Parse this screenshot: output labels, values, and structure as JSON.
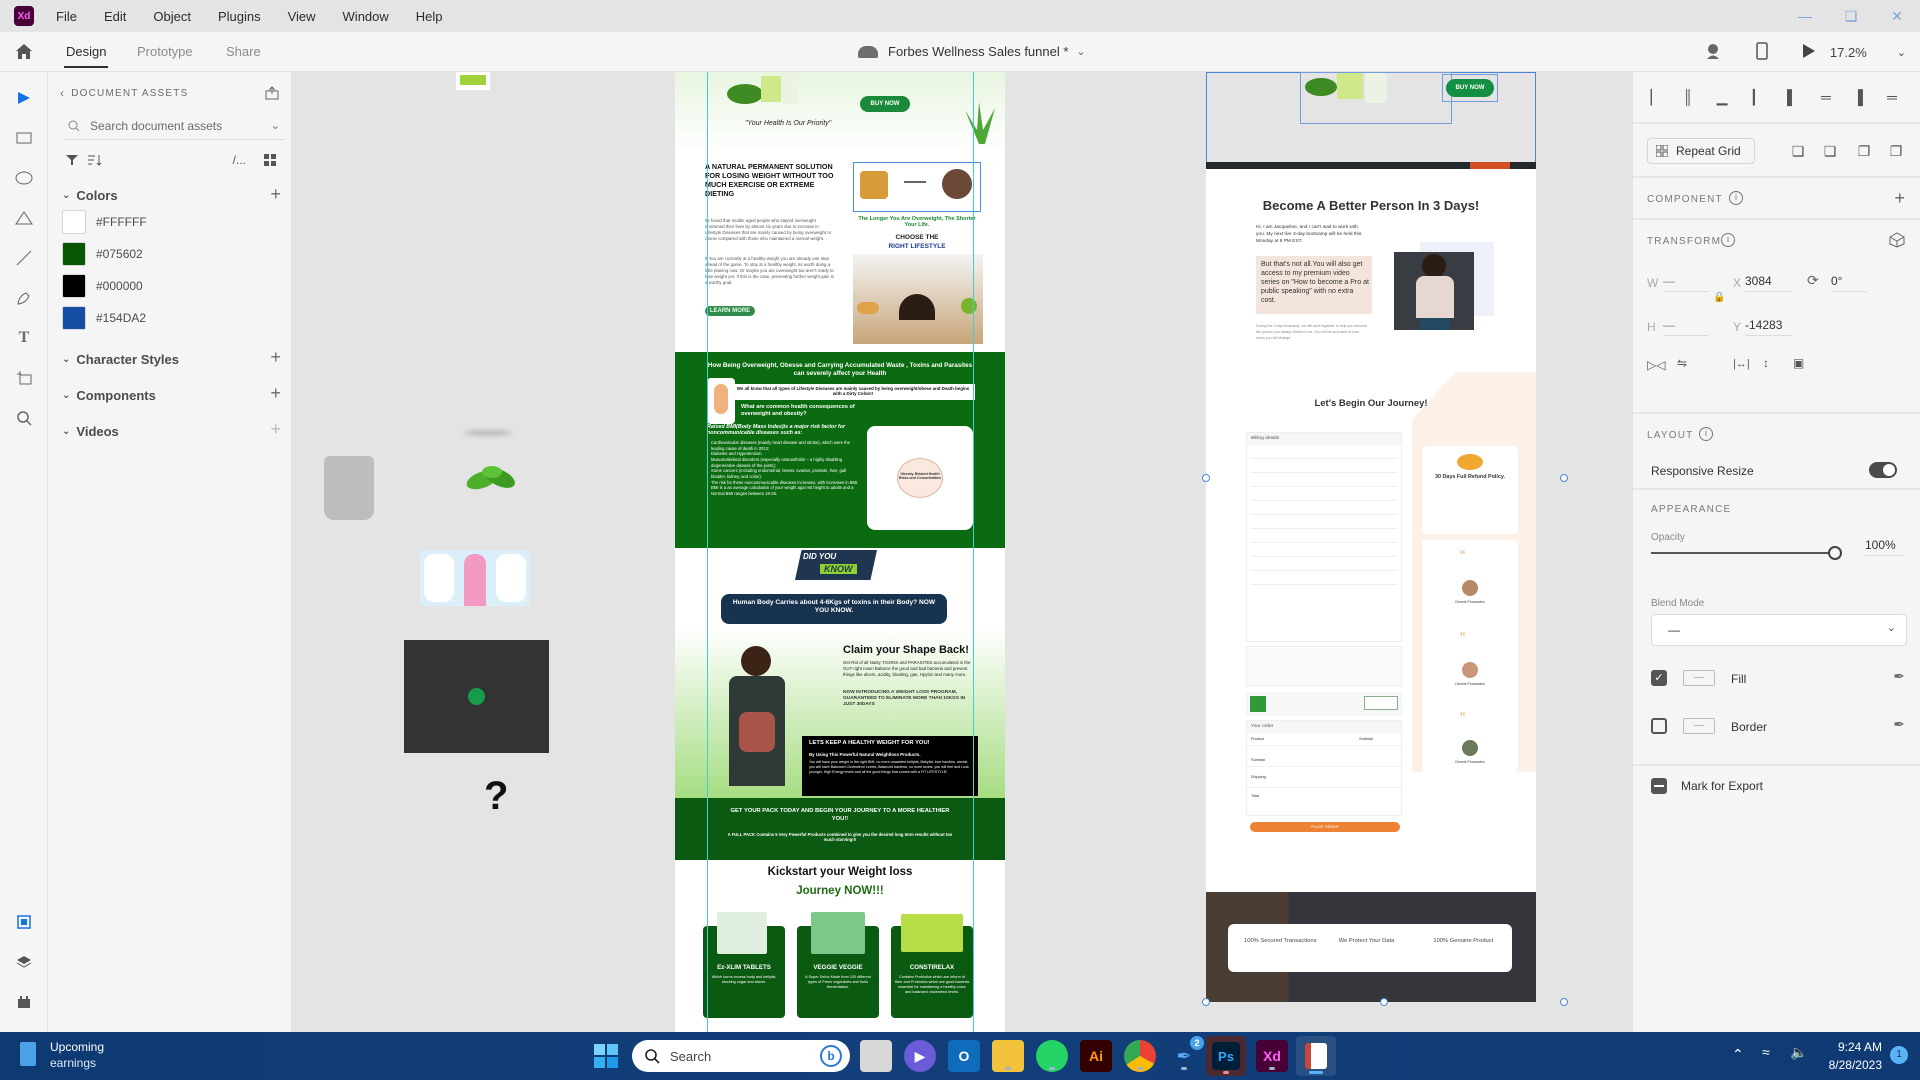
{
  "app": {
    "logo": "Xd",
    "menu": [
      "File",
      "Edit",
      "Object",
      "Plugins",
      "View",
      "Window",
      "Help"
    ],
    "window_controls": [
      "minimize-icon",
      "restore-icon",
      "close-icon"
    ]
  },
  "modebar": {
    "tabs": [
      "Design",
      "Prototype",
      "Share"
    ],
    "active_tab": "Design",
    "document_title": "Forbes Wellness Sales funnel *",
    "zoom": "17.2%"
  },
  "toolbar": {
    "tools": [
      "select-tool",
      "rectangle-tool",
      "ellipse-tool",
      "polygon-tool",
      "line-tool",
      "pen-tool",
      "text-tool",
      "artboard-tool",
      "zoom-tool"
    ],
    "bottom": [
      "assets-panel",
      "layers-panel",
      "plugins-panel"
    ]
  },
  "assets": {
    "header": "DOCUMENT ASSETS",
    "search_placeholder": "Search document assets",
    "sections": {
      "colors": "Colors",
      "character_styles": "Character Styles",
      "components": "Components",
      "videos": "Videos"
    },
    "colors": [
      {
        "hex": "#FFFFFF",
        "label": "#FFFFFF"
      },
      {
        "hex": "#075602",
        "label": "#075602"
      },
      {
        "hex": "#000000",
        "label": "#000000"
      },
      {
        "hex": "#154DA2",
        "label": "#154DA2"
      }
    ]
  },
  "canvas": {
    "loose_items": {
      "question_mark": "?"
    },
    "artboard1": {
      "tagline": "\"Your Health Is Our Priority\"",
      "buy_now": "BUY NOW",
      "solution_heading": "A NATURAL PERMANENT SOLUTION FOR LOSING WEIGHT WITHOUT TOO MUCH EXERCISE OR EXTREME DIETING",
      "para1": "Its found that middle aged people who stayed overweight shortened their lives by almost six years due to increase in Lifestyle Diseases that are mainly caused by being overweight or obese compared with those who maintained a normal weight.",
      "para2": "If You are currently at a healthy weight you are already one step ahead of the game. To stay at a healthy weight, its worth doing a little planing now. Or maybe you are overweight but aren't ready to lose weight yet. If this is the case, preventing further weight gain is a worthy goal.",
      "learn_more": "LEARN MORE",
      "overweight_caption": "The Longer You Are Overweight, The Shorter Your Life.",
      "choose_the": "CHOOSE THE",
      "right_lifestyle": "RIGHT LIFESTYLE",
      "health_heading": "How Being Overweight, Obesse and Carrying Accumulated Waste , Toxins and Parasites can severely affect your Health",
      "colon_note": "We all know that all types of Lifestyle Diseases are mainly caused by being overweight/obese and Death begins with a Dirty Colon!!",
      "consequences_q": "What are common health consequences of overweight and obesity?",
      "bmi_heading": "Raised BMI(Body Mass Index)is a major risk factor for noncommunicable diseases such as:",
      "bmi_list": [
        "Cardiovascular diseases (mainly heart disease and stroke), which were the leading cause of death in 2012;",
        "Diabetes and Hypertension.",
        "Musculoskeletal disorders (especially osteoarthritis – a highly disabling degenerative disease of the joints);",
        "Some cancers (including endometrial, breast, ovarian, prostate, liver, gall bladder, kidney, and colon).",
        "The risk for these noncommunicable diseases increases, with increases in BMI.",
        "BMI is a an average calculation of your weight agai nst height to adults and a Normal BMI ranges between 18-25."
      ],
      "diagram_center": "Obesity-Related Health Risks and Comorbidities",
      "did_you": "DID YOU",
      "know": "KNOW",
      "toxins_fact": "Human Body Carries about 4-6Kgs of toxins in their Body? NOW YOU KNOW.",
      "claim_heading": "Claim your Shape Back!",
      "claim_text": "Get Rid of all Nasty TOXINS and PARASITES accumulated in the GUT right now!! Balance the good and bad bacteria and prevent things like ulcers, acidity, bloating, gas, Hpylori and many more.",
      "introducing": "NOW INTRODUCING A WEIGHT LOSS PROGRAM, GUARANTEED TO ELIMINATE MORE THAN 10KGS IN JUST 30DAYS",
      "healthy_weight": "LETS KEEP A HEALTHY WEIGHT FOR YOU!",
      "using_products": "By Using This Powerful Natural Weightloss Products.",
      "results_text": "You will have your weight in the right BMI, no more unwanted bellyfat, Babyfat, love handles, armfat, you will have Balanced Cholesterol Levels, Balanced bacteria, no more toxins, you will feel and Look younger, High Energy levels and all the good things that comes with a FIT LIFESTYLE!",
      "get_pack": "GET YOUR PACK TODAY AND BEGIN YOUR JOURNEY TO A MORE HEALTHIER YOU!!",
      "full_pack": "A FULL PACK Contains 5 Very Powerful Products combined to give you the desired long term results without too much starving!!!",
      "kickstart": "Kickstart your Weight loss",
      "journey_now": "Journey NOW!!!",
      "products": [
        {
          "name": "Ez-XLIM TABLETS",
          "desc": "Which burns excess body and bellyfat, blocking sugar and starch."
        },
        {
          "name": "VEGGIE VEGGIE",
          "desc": "A Super Detox Made from 100 different types of Fresh vegetables and fruits fermentation."
        },
        {
          "name": "CONSTIRELAX",
          "desc": "Contains Probiotics which are Inform of fiber and Probiotics which are good bacteria essential for maintaining a healthy colon and balanced cholesterol levels."
        }
      ]
    },
    "artboard2": {
      "buy_now": "BUY NOW",
      "headline": "Become A Better Person In 3 Days!",
      "intro": "Hi, I am Jacqueline, and I can't wait to work with you. My next live 3-day bootcamp will be held this Monday at 6 PM EST.",
      "quote": "But that's not all.You will also get access to my premium video series on \"How to become a Pro at public speaking\" with no extra cost.",
      "small_text": "During the 3-day bootcamp, we will work together to help you become the person you always thrived to be. You will be surprised at how much you will change.",
      "journey": "Let's Begin Our Journey!",
      "billing_details": "Billing details",
      "refund_title": "30 Days Full Refund Policy.",
      "reviewer": "Dennis Fernandes",
      "your_order": "Your order",
      "order_cols": [
        "Product",
        "Subtotal"
      ],
      "order_rows": [
        "Subtotal",
        "Shipping",
        "Total"
      ],
      "place_order": "PLACE ORDER",
      "trust": [
        "100% Secured Transactions",
        "We Protect Your Data",
        "100% Genuine Product"
      ]
    }
  },
  "inspector": {
    "repeat_grid": "Repeat Grid",
    "component_label": "COMPONENT",
    "transform_label": "TRANSFORM",
    "w_label": "W",
    "h_label": "H",
    "x_label": "X",
    "y_label": "Y",
    "w_value": "—",
    "h_value": "—",
    "x_value": "3084",
    "y_value": "-14283",
    "rotation": "0°",
    "layout_label": "LAYOUT",
    "responsive_resize": "Responsive Resize",
    "responsive_on": true,
    "appearance_label": "APPEARANCE",
    "opacity_label": "Opacity",
    "opacity_value": "100%",
    "opacity_fraction": 1.0,
    "blend_label": "Blend Mode",
    "blend_value": "—",
    "fill_label": "Fill",
    "fill_checked": true,
    "border_label": "Border",
    "border_checked": false,
    "export_label": "Mark for Export"
  },
  "taskbar": {
    "widget_line1": "Upcoming",
    "widget_line2": "earnings",
    "search_placeholder": "Search",
    "apps": [
      "task-view",
      "teams",
      "outlook",
      "file-explorer",
      "whatsapp",
      "illustrator",
      "chrome",
      "pen-app",
      "photoshop",
      "xd",
      "snipping-tool"
    ],
    "pen_badge": "2",
    "time": "9:24 AM",
    "date": "8/28/2023",
    "notification_count": "1"
  }
}
